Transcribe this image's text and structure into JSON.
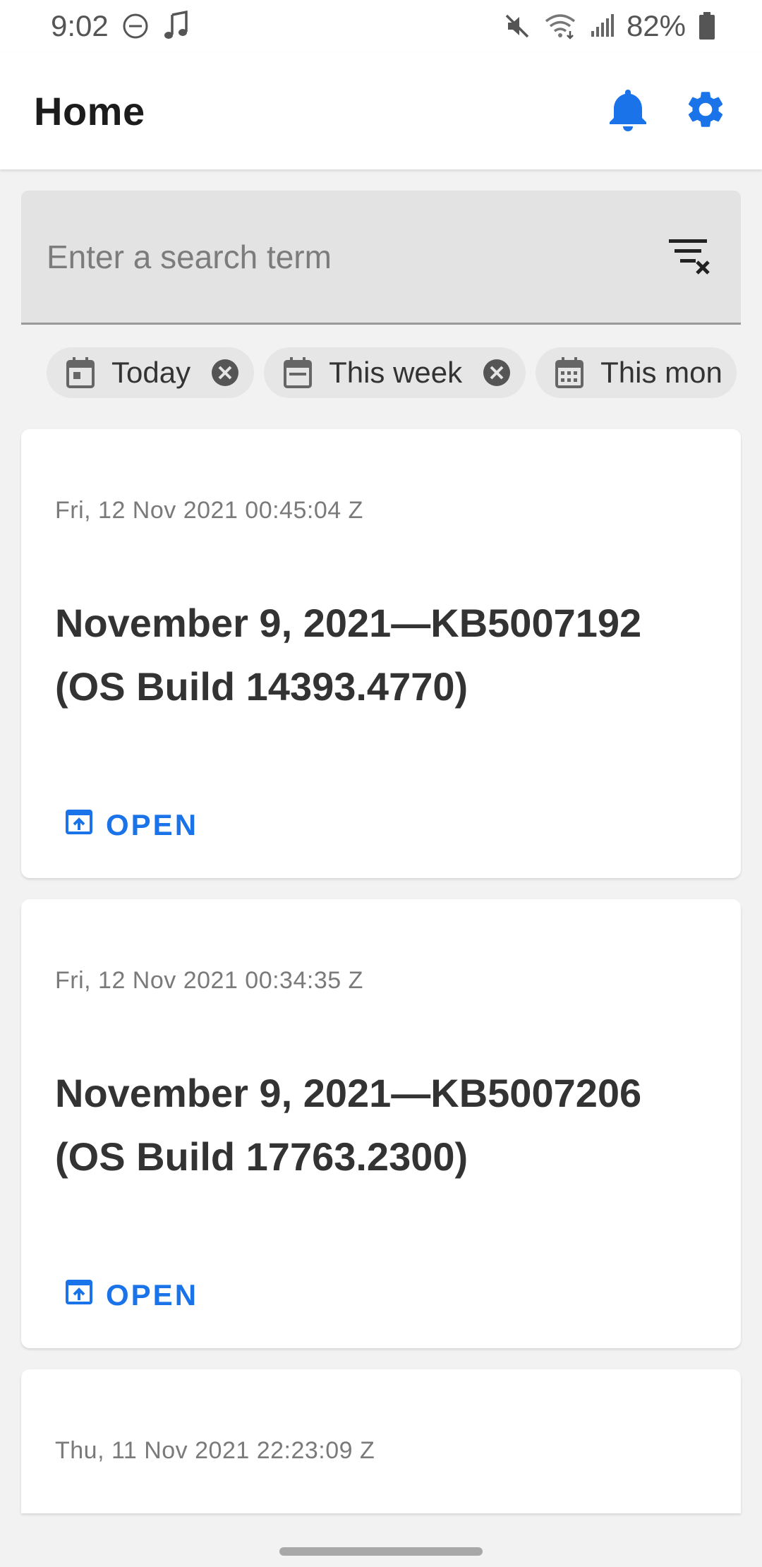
{
  "status_bar": {
    "time": "9:02",
    "battery": "82%"
  },
  "app_bar": {
    "title": "Home"
  },
  "search": {
    "placeholder": "Enter a search term"
  },
  "chips": [
    {
      "label": "Today"
    },
    {
      "label": "This week"
    },
    {
      "label": "This mon"
    }
  ],
  "cards": [
    {
      "date": "Fri, 12 Nov 2021 00:45:04 Z",
      "title": "November 9, 2021—KB5007192 (OS Build 14393.4770)",
      "action": "OPEN"
    },
    {
      "date": "Fri, 12 Nov 2021 00:34:35 Z",
      "title": "November 9, 2021—KB5007206 (OS Build 17763.2300)",
      "action": "OPEN"
    },
    {
      "date": "Thu, 11 Nov 2021 22:23:09 Z"
    }
  ],
  "colors": {
    "accent": "#1a73e8",
    "background": "#f2f2f2",
    "surface": "#ffffff",
    "search_fill": "#e3e3e3"
  },
  "icons": {
    "status": [
      "dnd-icon",
      "music-note-icon",
      "mute-icon",
      "wifi-icon",
      "signal-icon",
      "battery-icon"
    ],
    "app_bar": [
      "bell-icon",
      "gear-icon"
    ],
    "search": "filter-clear-icon",
    "chips": [
      "calendar-today-icon",
      "calendar-week-icon",
      "calendar-month-icon",
      "close-circle-icon"
    ],
    "card_action": "open-in-app-icon"
  }
}
